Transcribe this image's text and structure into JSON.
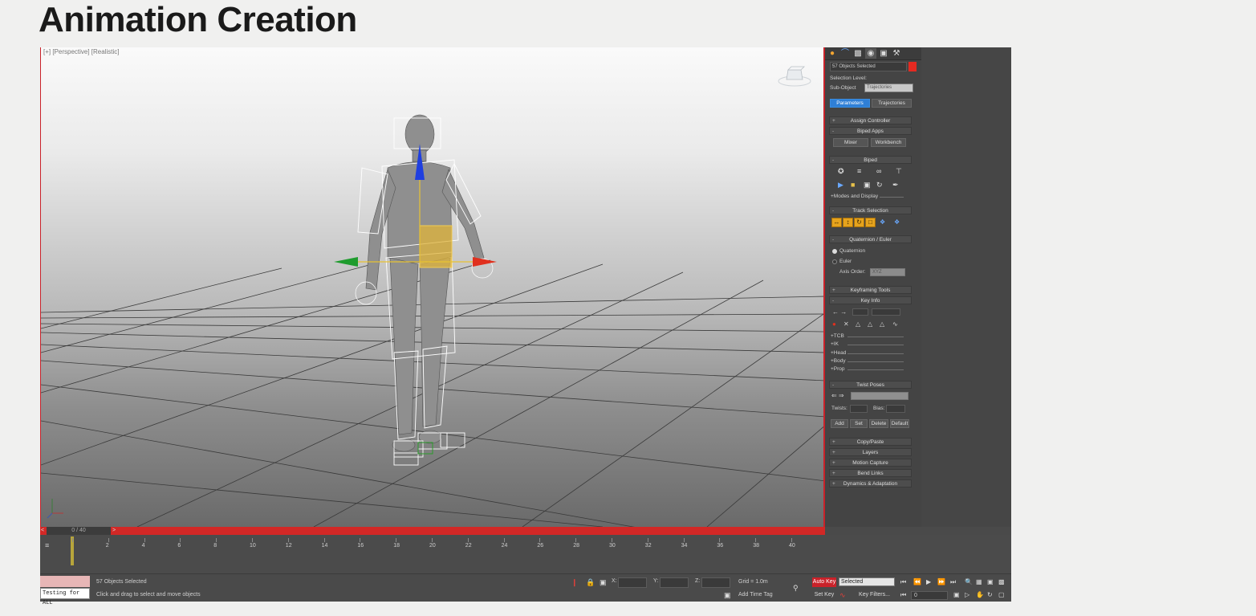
{
  "slide": {
    "title": "Animation Creation"
  },
  "viewport": {
    "label": "[+] [Perspective] [Realistic]"
  },
  "time_slider": {
    "frame_display": "0 / 40",
    "prev": "<",
    "next": ">"
  },
  "trackbar": {
    "ticks": [
      "0",
      "2",
      "4",
      "6",
      "8",
      "10",
      "12",
      "14",
      "16",
      "18",
      "20",
      "22",
      "24",
      "26",
      "28",
      "30",
      "32",
      "34",
      "36",
      "38",
      "40"
    ]
  },
  "command_panel": {
    "selection_name": "57 Objects Selected",
    "selection_level_label": "Selection Level:",
    "sub_object_label": "Sub-Object",
    "sub_object_value": "Trajectories",
    "tab_parameters": "Parameters",
    "tab_trajectories": "Trajectories",
    "assign_controller": "Assign Controller",
    "biped_apps": "Biped Apps",
    "mixer": "Mixer",
    "workbench": "Workbench",
    "biped": "Biped",
    "modes_display": "+Modes and Display",
    "track_selection": "Track Selection",
    "quaternion_euler": "Quaternion / Euler",
    "quaternion": "Quaternion",
    "euler": "Euler",
    "axis_order_label": "Axis Order:",
    "axis_order_value": "XYZ",
    "keyframing_tools": "Keyframing Tools",
    "key_info": "Key Info",
    "key_info_items": [
      "+TCB",
      "+IK",
      "+Head",
      "+Body",
      "+Prop"
    ],
    "twist_poses": "Twist Poses",
    "twists_label": "Twists:",
    "bias_label": "Bias:",
    "add": "Add",
    "set": "Set",
    "delete": "Delete",
    "default": "Default",
    "copy_paste": "Copy/Paste",
    "layers": "Layers",
    "motion_capture": "Motion Capture",
    "bend_links": "Bend Links",
    "dynamics_adaptation": "Dynamics & Adaptation"
  },
  "status": {
    "maxscript_text": "Testing for ALL",
    "selected_text": "57 Objects Selected",
    "prompt_text": "Click and drag to select and move objects",
    "x_label": "X:",
    "y_label": "Y:",
    "z_label": "Z:",
    "grid": "Grid = 1.0m",
    "add_time_tag": "Add Time Tag",
    "auto_key": "Auto Key",
    "set_key": "Set Key",
    "key_mode": "Selected",
    "key_filters": "Key Filters...",
    "current_frame": "0"
  },
  "colors": {
    "accent_red": "#c9222a",
    "highlight_blue": "#2f7fd6",
    "track_yellow": "#e6a31d"
  }
}
